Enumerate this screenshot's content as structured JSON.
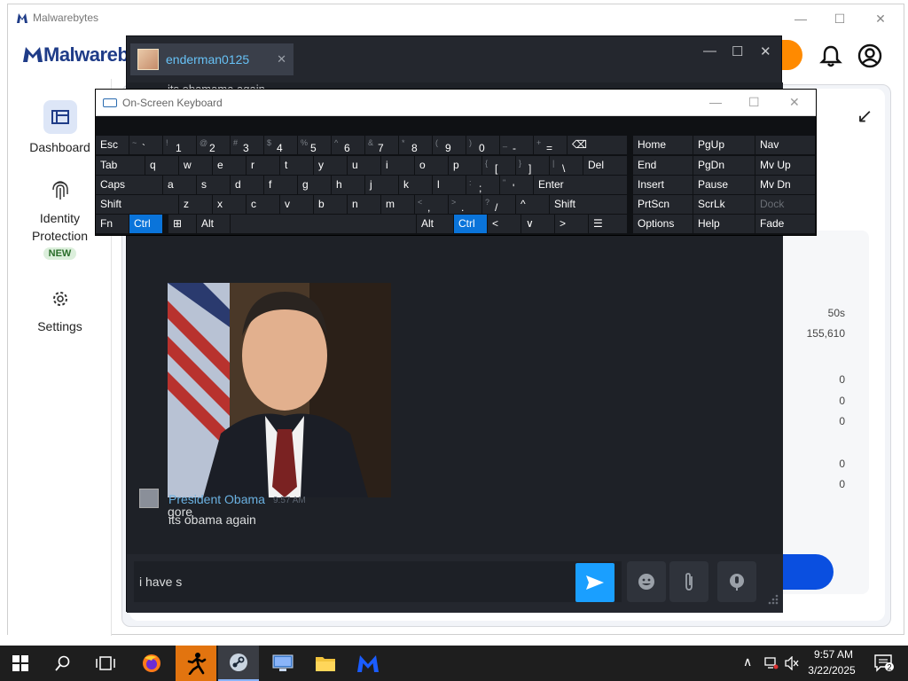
{
  "malwarebytes": {
    "window_title": "Malwarebytes",
    "logo_text": "Malwarebyt",
    "sidebar": {
      "dashboard": "Dashboard",
      "identity_line1": "Identity",
      "identity_line2": "Protection",
      "new_badge": "NEW",
      "settings": "Settings"
    },
    "stats": {
      "time": "50s",
      "items": "155,610",
      "zero_a": "0",
      "zero_b": "0",
      "zero_c": "0",
      "zero_d": "0",
      "zero_e": "0"
    },
    "colors": {
      "brand": "#1f3c88",
      "scan_button": "#0a4fe0",
      "orange": "#ff8a00"
    }
  },
  "chat": {
    "tab_name": "enderman0125",
    "partial_top_text": "its obamama again",
    "image_caption": "gore",
    "message2": {
      "sender": "President Obama",
      "time": "9:57 AM",
      "text": "its obama again"
    },
    "input_value": "i have s",
    "icons": {
      "send": "send-icon",
      "emoji": "emoji-icon",
      "attach": "paperclip-icon",
      "voice": "microphone-icon"
    }
  },
  "osk": {
    "title": "On-Screen Keyboard",
    "row1": [
      {
        "sub": "",
        "main": "Esc"
      },
      {
        "sub": "~",
        "main": "`"
      },
      {
        "sub": "!",
        "main": "1"
      },
      {
        "sub": "@",
        "main": "2"
      },
      {
        "sub": "#",
        "main": "3"
      },
      {
        "sub": "$",
        "main": "4"
      },
      {
        "sub": "%",
        "main": "5"
      },
      {
        "sub": "^",
        "main": "6"
      },
      {
        "sub": "&",
        "main": "7"
      },
      {
        "sub": "*",
        "main": "8"
      },
      {
        "sub": "(",
        "main": "9"
      },
      {
        "sub": ")",
        "main": "0"
      },
      {
        "sub": "_",
        "main": "-"
      },
      {
        "sub": "+",
        "main": "="
      },
      {
        "sub": "",
        "main": "⌫"
      }
    ],
    "row2": [
      "Tab",
      "q",
      "w",
      "e",
      "r",
      "t",
      "y",
      "u",
      "i",
      "o",
      "p",
      "[",
      "]",
      "\\",
      "Del"
    ],
    "row2_subs": [
      "",
      "",
      "",
      "",
      "",
      "",
      "",
      "",
      "",
      "",
      "",
      "{",
      "}",
      "|",
      ""
    ],
    "row3": [
      "Caps",
      "a",
      "s",
      "d",
      "f",
      "g",
      "h",
      "j",
      "k",
      "l",
      ";",
      "'",
      "Enter"
    ],
    "row3_subs": [
      "",
      "",
      "",
      "",
      "",
      "",
      "",
      "",
      "",
      "",
      ":",
      "\"",
      ""
    ],
    "row4": [
      "Shift",
      "z",
      "x",
      "c",
      "v",
      "b",
      "n",
      "m",
      ",",
      ".",
      "/",
      "^",
      "Shift"
    ],
    "row4_subs": [
      "",
      "",
      "",
      "",
      "",
      "",
      "",
      "",
      "<",
      ">",
      "?",
      "",
      ""
    ],
    "row5": [
      "Fn",
      "Ctrl",
      "⊞",
      "Alt",
      "",
      "Alt",
      "Ctrl",
      "<",
      "∨",
      ">",
      "☰"
    ],
    "nav_col1": [
      "Home",
      "End",
      "Insert",
      "PrtScn",
      "Options"
    ],
    "nav_col2": [
      "PgUp",
      "PgDn",
      "Pause",
      "ScrLk",
      "Help"
    ],
    "nav_col3": [
      "Nav",
      "Mv Up",
      "Mv Dn",
      "Dock",
      "Fade"
    ],
    "highlight_color": "#0a74da"
  },
  "taskbar": {
    "time": "9:57 AM",
    "date": "3/22/2025",
    "notification_count": "2"
  }
}
